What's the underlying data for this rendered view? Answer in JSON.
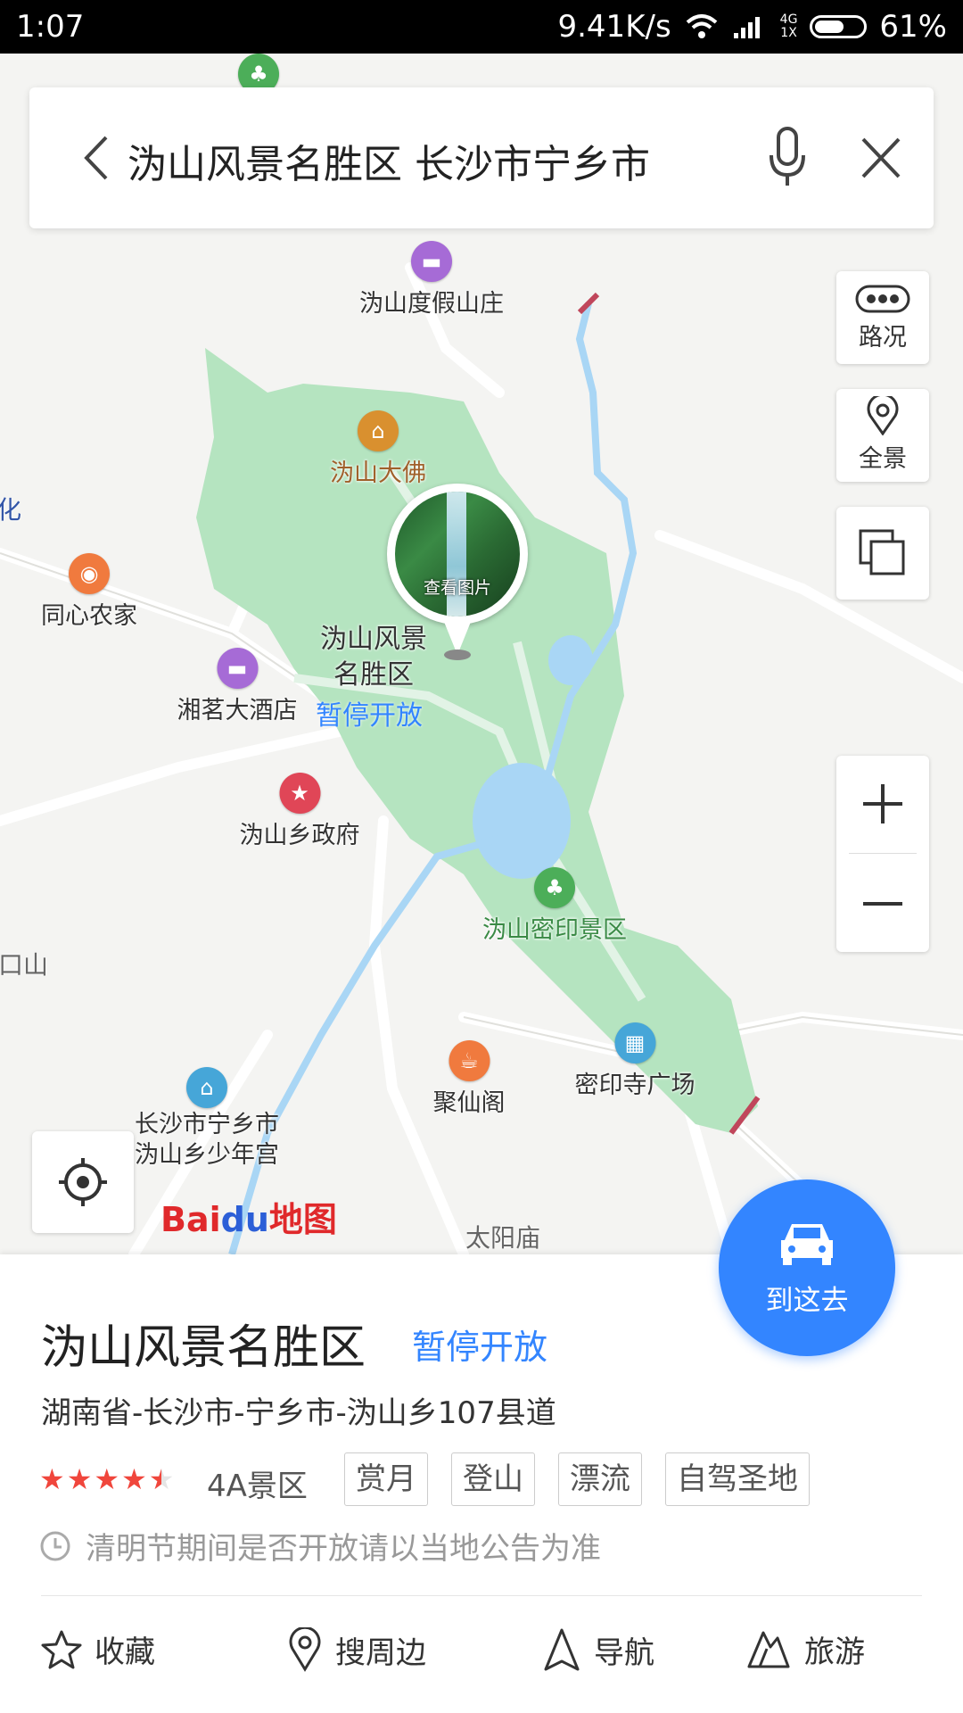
{
  "status_bar": {
    "time": "1:07",
    "net_speed": "9.41K/s",
    "network_tag_top": "4G",
    "network_tag_bottom": "1X",
    "battery": "61%",
    "battery_level": 0.61
  },
  "search": {
    "query": "沩山风景名胜区 长沙市宁乡市",
    "back_icon": "back-arrow-icon",
    "mic_icon": "microphone-icon",
    "close_icon": "close-icon"
  },
  "map_controls": {
    "traffic_label": "路况",
    "panorama_label": "全景",
    "layers_icon": "layers-icon",
    "zoom_in": "+",
    "zoom_out": "—"
  },
  "map": {
    "photo_label": "查看图片",
    "selected_name_line1": "沩山风景",
    "selected_name_line2": "名胜区",
    "selected_status": "暂停开放",
    "logo_bai": "Bai",
    "logo_du": "du",
    "logo_map": "地图",
    "pois": [
      {
        "name": "沩山度假山庄",
        "type": "hotel",
        "color": "#a66bd6"
      },
      {
        "name": "沩山大佛",
        "type": "museum",
        "color": "#d9902f"
      },
      {
        "name": "同心农家",
        "type": "restaurant",
        "color": "#f07a3e"
      },
      {
        "name": "湘茗大酒店",
        "type": "hotel",
        "color": "#a66bd6"
      },
      {
        "name": "沩山乡政府",
        "type": "government",
        "color": "#e04657"
      },
      {
        "name": "沩山密印景区",
        "type": "scenic",
        "color": "#4cae59"
      },
      {
        "name": "聚仙阁",
        "type": "cafe",
        "color": "#f07a3e"
      },
      {
        "name": "密印寺广场",
        "type": "building",
        "color": "#46a6d8"
      },
      {
        "name": "长沙市宁乡市\n沩山乡少年宫",
        "type": "museum",
        "color": "#46a6d8"
      }
    ],
    "place_labels": [
      "口山",
      "太阳庙",
      "化"
    ]
  },
  "go_button": {
    "label": "到这去"
  },
  "detail": {
    "title": "沩山风景名胜区",
    "status": "暂停开放",
    "address": "湖南省-长沙市-宁乡市-沩山乡107县道",
    "rating": 4.5,
    "level": "4A景区",
    "tags": [
      "赏月",
      "登山",
      "漂流",
      "自驾圣地"
    ],
    "notice": "清明节期间是否开放请以当地公告为准",
    "actions": [
      {
        "label": "收藏",
        "icon": "star-icon"
      },
      {
        "label": "搜周边",
        "icon": "location-pin-icon"
      },
      {
        "label": "导航",
        "icon": "navigation-arrow-icon"
      },
      {
        "label": "旅游",
        "icon": "travel-icon"
      }
    ]
  },
  "colors": {
    "accent": "#3385ff",
    "park_green": "#b5e4c0",
    "water": "#a9d6f5",
    "rating_star": "#f0463c"
  }
}
